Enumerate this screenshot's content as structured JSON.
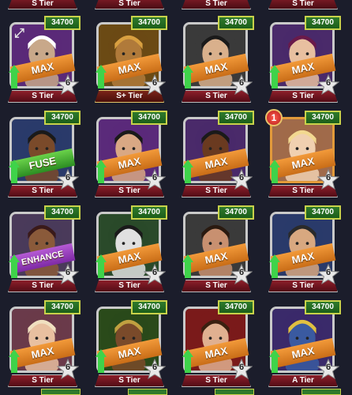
{
  "top_tiers": [
    "S Tier",
    "S Tier",
    "S Tier",
    "S Tier"
  ],
  "cards": [
    {
      "power": "34700",
      "label": "MAX",
      "label_style": "orange",
      "stars": "6",
      "tier": "S Tier",
      "tier_style": "normal",
      "bg": "#5a2a78",
      "skin": "#c8a88a",
      "hair": "#ffffff",
      "frame": "silver",
      "badge": "",
      "corner_icon": "↗"
    },
    {
      "power": "34700",
      "label": "MAX",
      "label_style": "orange",
      "stars": "6",
      "tier": "S+ Tier",
      "tier_style": "gold",
      "bg": "#6b4a14",
      "skin": "#b07a3a",
      "hair": "#d9a040",
      "frame": "silver",
      "badge": "",
      "corner_icon": ""
    },
    {
      "power": "34700",
      "label": "MAX",
      "label_style": "orange",
      "stars": "6",
      "tier": "S Tier",
      "tier_style": "normal",
      "bg": "#3a3a3a",
      "skin": "#d9b08c",
      "hair": "#1a1a1a",
      "frame": "silver",
      "badge": "",
      "corner_icon": ""
    },
    {
      "power": "34700",
      "label": "MAX",
      "label_style": "orange",
      "stars": "6",
      "tier": "S Tier",
      "tier_style": "normal",
      "bg": "#4a2a6a",
      "skin": "#e8c0a0",
      "hair": "#6a1a4a",
      "frame": "silver",
      "badge": "",
      "corner_icon": ""
    },
    {
      "power": "34700",
      "label": "FUSE",
      "label_style": "green",
      "stars": "6",
      "tier": "S Tier",
      "tier_style": "normal",
      "bg": "#2a3a6a",
      "skin": "#7a4a2a",
      "hair": "#1a1a1a",
      "frame": "silver",
      "badge": "",
      "corner_icon": ""
    },
    {
      "power": "34700",
      "label": "MAX",
      "label_style": "orange",
      "stars": "6",
      "tier": "S Tier",
      "tier_style": "normal",
      "bg": "#5a2a7a",
      "skin": "#d9a884",
      "hair": "#1a1a1a",
      "frame": "silver",
      "badge": "",
      "corner_icon": ""
    },
    {
      "power": "34700",
      "label": "MAX",
      "label_style": "orange",
      "stars": "6",
      "tier": "S Tier",
      "tier_style": "normal",
      "bg": "#4a2a6a",
      "skin": "#6a3a20",
      "hair": "#1a1a1a",
      "frame": "silver",
      "badge": "",
      "corner_icon": ""
    },
    {
      "power": "34700",
      "label": "MAX",
      "label_style": "orange",
      "stars": "6",
      "tier": "S Tier",
      "tier_style": "normal",
      "bg": "#a06a4a",
      "skin": "#f0d0b0",
      "hair": "#f2d890",
      "frame": "orange",
      "badge": "1",
      "corner_icon": ""
    },
    {
      "power": "34700",
      "label": "ENHANCE",
      "label_style": "purple",
      "stars": "6",
      "tier": "S Tier",
      "tier_style": "normal",
      "bg": "#4a3a5a",
      "skin": "#8a5a3a",
      "hair": "#3a1a1a",
      "frame": "silver",
      "badge": "",
      "corner_icon": ""
    },
    {
      "power": "34700",
      "label": "MAX",
      "label_style": "orange",
      "stars": "6",
      "tier": "S Tier",
      "tier_style": "normal",
      "bg": "#2a4a2a",
      "skin": "#e0e0e0",
      "hair": "#1a1a1a",
      "frame": "silver",
      "badge": "",
      "corner_icon": ""
    },
    {
      "power": "34700",
      "label": "MAX",
      "label_style": "orange",
      "stars": "6",
      "tier": "S Tier",
      "tier_style": "normal",
      "bg": "#3a3a3a",
      "skin": "#c89070",
      "hair": "#2a1a10",
      "frame": "silver",
      "badge": "",
      "corner_icon": ""
    },
    {
      "power": "34700",
      "label": "MAX",
      "label_style": "orange",
      "stars": "6",
      "tier": "S Tier",
      "tier_style": "normal",
      "bg": "#2a3a6a",
      "skin": "#d8a880",
      "hair": "#2a2a2a",
      "frame": "silver",
      "badge": "",
      "corner_icon": ""
    },
    {
      "power": "34700",
      "label": "MAX",
      "label_style": "orange",
      "stars": "6",
      "tier": "S Tier",
      "tier_style": "normal",
      "bg": "#6a3a4a",
      "skin": "#e8c0a0",
      "hair": "#f0e0c0",
      "frame": "silver",
      "badge": "",
      "corner_icon": ""
    },
    {
      "power": "34700",
      "label": "MAX",
      "label_style": "orange",
      "stars": "6",
      "tier": "S Tier",
      "tier_style": "normal",
      "bg": "#2a4a1a",
      "skin": "#7a4a2a",
      "hair": "#c0a040",
      "frame": "silver",
      "badge": "",
      "corner_icon": ""
    },
    {
      "power": "34700",
      "label": "MAX",
      "label_style": "orange",
      "stars": "6",
      "tier": "S Tier",
      "tier_style": "normal",
      "bg": "#7a1a1a",
      "skin": "#e0b090",
      "hair": "#3a2010",
      "frame": "silver",
      "badge": "",
      "corner_icon": ""
    },
    {
      "power": "34700",
      "label": "MAX",
      "label_style": "orange",
      "stars": "6",
      "tier": "A Tier",
      "tier_style": "normal",
      "bg": "#3a2a6a",
      "skin": "#3a5aa0",
      "hair": "#e0c040",
      "frame": "silver",
      "badge": "",
      "corner_icon": ""
    }
  ],
  "colors": {
    "background": "#1b1d2b",
    "power_green": "#2f7a2c",
    "power_border": "#c8d24a",
    "tier_red": "#8c1f2a",
    "max_orange": "#f29a3a",
    "fuse_green": "#6ad24a",
    "enhance_purple": "#b55ad4",
    "upgrade_arrow": "#3fd34a"
  }
}
